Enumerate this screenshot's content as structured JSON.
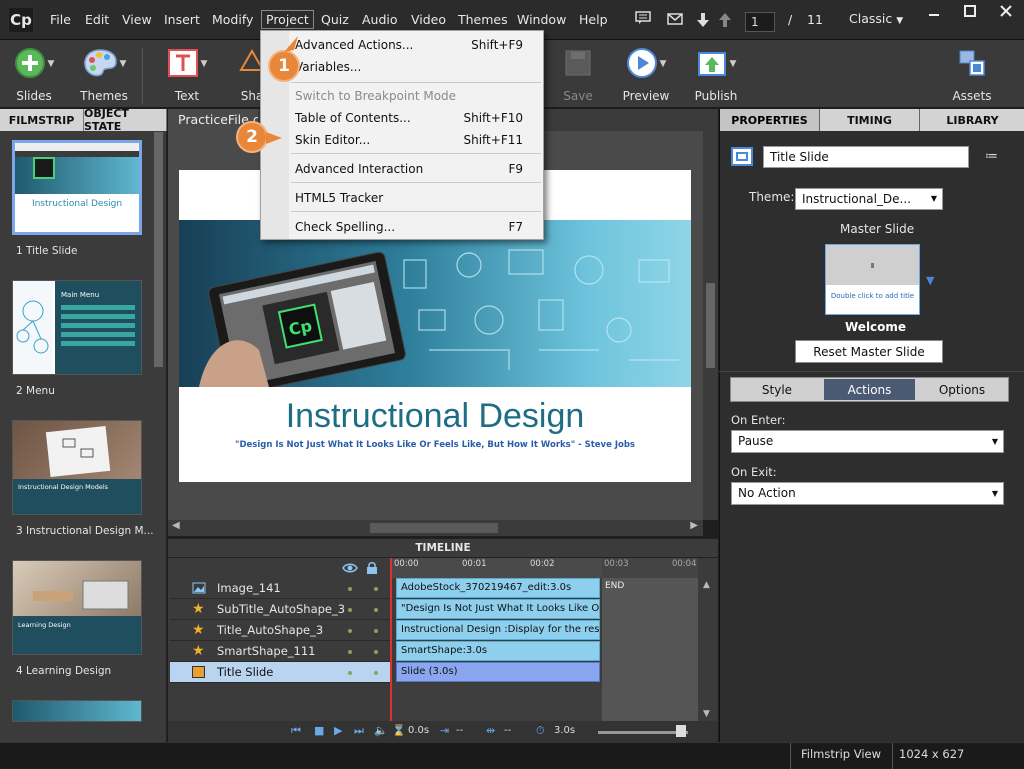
{
  "menubar": {
    "logo": "Cp",
    "items": [
      "File",
      "Edit",
      "View",
      "Insert",
      "Modify",
      "Project",
      "Quiz",
      "Audio",
      "Video",
      "Themes",
      "Window",
      "Help"
    ],
    "active": "Project",
    "page_current": "1",
    "page_sep": "/",
    "page_total": "11",
    "workspace": "Classic"
  },
  "toolbar": {
    "slides": "Slides",
    "themes": "Themes",
    "text": "Text",
    "shapes": "Sha",
    "save": "Save",
    "preview": "Preview",
    "publish": "Publish",
    "assets": "Assets"
  },
  "dropdown": {
    "items": [
      {
        "label": "Advanced Actions...",
        "shortcut": "Shift+F9",
        "disabled": false
      },
      {
        "label": "Variables...",
        "shortcut": "",
        "disabled": false
      },
      {
        "label": "Switch to Breakpoint Mode",
        "shortcut": "",
        "disabled": true
      },
      {
        "label": "Table of Contents...",
        "shortcut": "Shift+F10",
        "disabled": false
      },
      {
        "label": "Skin Editor...",
        "shortcut": "Shift+F11",
        "disabled": false
      },
      {
        "label": "Advanced Interaction",
        "shortcut": "F9",
        "disabled": false
      },
      {
        "label": "HTML5 Tracker",
        "shortcut": "",
        "disabled": false
      },
      {
        "label": "Check Spelling...",
        "shortcut": "F7",
        "disabled": false
      }
    ]
  },
  "callouts": {
    "one": "1",
    "two": "2"
  },
  "leftpanel": {
    "tab_filmstrip": "FILMSTRIP",
    "tab_object_state": "OBJECT STATE",
    "slides": [
      {
        "label": "1 Title Slide"
      },
      {
        "label": "2 Menu"
      },
      {
        "label": "3 Instructional Design M..."
      },
      {
        "label": "4 Learning Design"
      }
    ],
    "thumb1": {
      "title": "Instructional Design"
    },
    "thumb2": {
      "title": "Main Menu"
    },
    "thumb3": {
      "title": "Instructional Design Models"
    },
    "thumb4": {
      "title": "Learning Design"
    }
  },
  "stage": {
    "tab": "PracticeFile.cp",
    "title": "Instructional Design",
    "quote": "\"Design Is Not Just What It Looks Like Or Feels Like, But How It Works\" - Steve Jobs"
  },
  "timeline": {
    "header": "TIMELINE",
    "rows": [
      {
        "name": "Image_141",
        "bar": "AdobeStock_370219467_edit:3.0s"
      },
      {
        "name": "SubTitle_AutoShape_3",
        "bar": "\"Design Is Not Just What It Looks Like Or F..."
      },
      {
        "name": "Title_AutoShape_3",
        "bar": "Instructional Design :Display for the rest of ..."
      },
      {
        "name": "SmartShape_111",
        "bar": "SmartShape:3.0s"
      },
      {
        "name": "Title Slide",
        "bar": "Slide (3.0s)"
      }
    ],
    "ticks": [
      "00:00",
      "00:01",
      "00:02",
      "00:03",
      "00:04"
    ],
    "end": "END",
    "time_current": "0.0s",
    "time_a": "--",
    "time_b": "--",
    "duration": "3.0s"
  },
  "rightpanel": {
    "tab_properties": "PROPERTIES",
    "tab_timing": "TIMING",
    "tab_library": "LIBRARY",
    "slide_name": "Title Slide",
    "theme_label": "Theme:",
    "theme_value": "Instructional_De...",
    "master_label": "Master Slide",
    "master_thumb_text": "Double click to add title",
    "master_name": "Welcome",
    "reset_button": "Reset Master Slide",
    "sub_tabs": [
      "Style",
      "Actions",
      "Options"
    ],
    "on_enter_label": "On Enter:",
    "on_enter_value": "Pause",
    "on_exit_label": "On Exit:",
    "on_exit_value": "No Action"
  },
  "statusbar": {
    "view": "Filmstrip View",
    "size": "1024 x 627"
  },
  "colors": {
    "accent": "#e8873a",
    "selection": "#7aa7e8",
    "timeline_bar": "#8ecfee"
  }
}
